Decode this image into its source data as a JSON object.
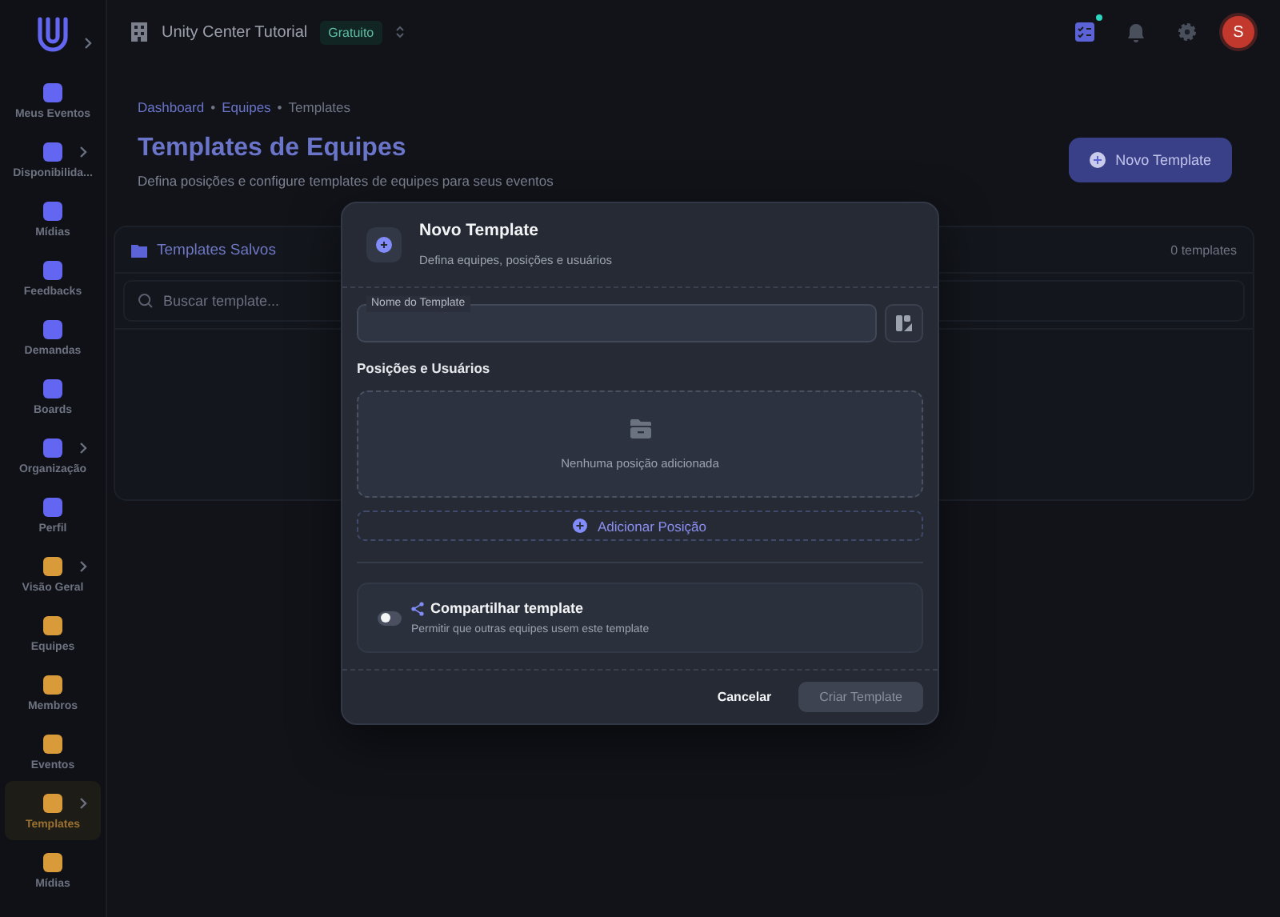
{
  "topbar": {
    "org_name": "Unity Center Tutorial",
    "plan_badge": "Gratuito",
    "tasks_notification": true,
    "avatar_initial": "S"
  },
  "sidebar": {
    "items": [
      {
        "label": "Meus Eventos",
        "color": "#6366f1",
        "expandable": false,
        "selected": false
      },
      {
        "label": "Disponibilida...",
        "color": "#6366f1",
        "expandable": true,
        "selected": false
      },
      {
        "label": "Mídias",
        "color": "#6366f1",
        "expandable": false,
        "selected": false
      },
      {
        "label": "Feedbacks",
        "color": "#6366f1",
        "expandable": false,
        "selected": false
      },
      {
        "label": "Demandas",
        "color": "#6366f1",
        "expandable": false,
        "selected": false
      },
      {
        "label": "Boards",
        "color": "#6366f1",
        "expandable": false,
        "selected": false
      },
      {
        "label": "Organização",
        "color": "#6366f1",
        "expandable": true,
        "selected": false
      },
      {
        "label": "Perfil",
        "color": "#6366f1",
        "expandable": false,
        "selected": false
      },
      {
        "label": "Visão Geral",
        "color": "#d99a3a",
        "expandable": true,
        "selected": false
      },
      {
        "label": "Equipes",
        "color": "#d99a3a",
        "expandable": false,
        "selected": false
      },
      {
        "label": "Membros",
        "color": "#d99a3a",
        "expandable": false,
        "selected": false
      },
      {
        "label": "Eventos",
        "color": "#d99a3a",
        "expandable": false,
        "selected": false
      },
      {
        "label": "Templates",
        "color": "#d99a3a",
        "expandable": true,
        "selected": true
      },
      {
        "label": "Mídias",
        "color": "#d99a3a",
        "expandable": false,
        "selected": false
      }
    ]
  },
  "page": {
    "breadcrumb": [
      {
        "label": "Dashboard",
        "current": false
      },
      {
        "label": "Equipes",
        "current": false
      },
      {
        "label": "Templates",
        "current": true
      }
    ],
    "breadcrumb_separator": "•",
    "title": "Templates de Equipes",
    "subtitle": "Defina posições e configure templates de equipes para seus eventos",
    "new_button": "Novo Template"
  },
  "saved_panel": {
    "title": "Templates Salvos",
    "count": "0 templates",
    "search_placeholder": "Buscar template..."
  },
  "dialog": {
    "title": "Novo Template",
    "subtitle": "Defina equipes, posições e usuários",
    "name_field": {
      "label": "Nome do Template"
    },
    "section_title": "Posições e Usuários",
    "empty_message": "Nenhuma posição adicionada",
    "add_button": "Adicionar Posição",
    "share": {
      "title": "Compartilhar template",
      "description": "Permitir que outras equipes usem este template",
      "on": false
    },
    "cancel_button": "Cancelar",
    "create_button": {
      "label": "Criar Template",
      "disabled": true
    }
  }
}
